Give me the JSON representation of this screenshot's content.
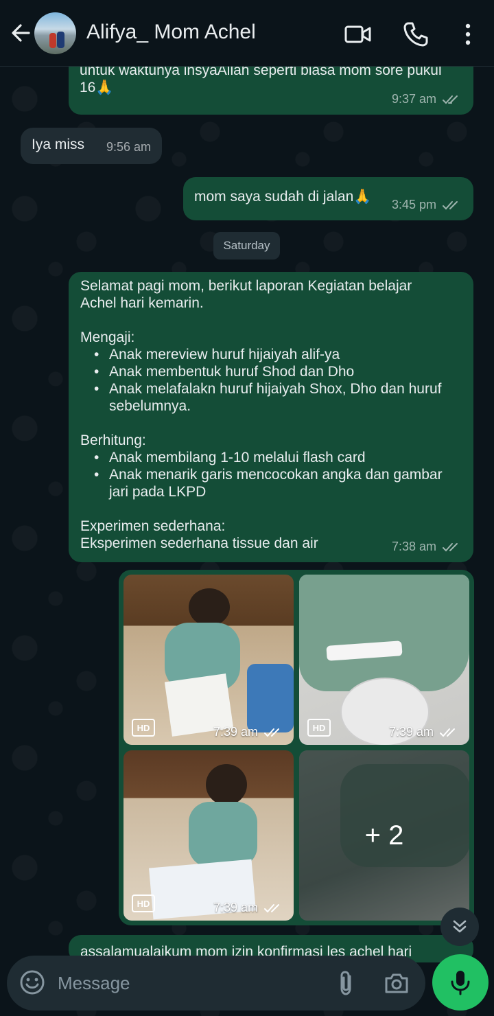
{
  "header": {
    "contact_name": "Alifya_ Mom Achel"
  },
  "messages": [
    {
      "text": "untuk waktunya insyaAllah seperti biasa mom sore pukul 16🙏",
      "line1": "untuk waktunya insyaAllah seperti biasa mom sore pukul",
      "line2": "16🙏",
      "time": "9:37 am",
      "direction": "outgoing"
    },
    {
      "text": "Iya miss",
      "time": "9:56 am",
      "direction": "incoming"
    },
    {
      "text": "mom saya sudah di jalan🙏",
      "time": "3:45 pm",
      "direction": "outgoing"
    }
  ],
  "date_divider": "Saturday",
  "report": {
    "greeting_l1": "Selamat pagi mom,  berikut laporan Kegiatan belajar",
    "greeting_l2": "Achel hari kemarin.",
    "mengaji_title": "Mengaji:",
    "mengaji_items": [
      "Anak mereview huruf hijaiyah alif-ya",
      "Anak membentuk huruf Shod dan Dho",
      "Anak melafalakn huruf hijaiyah Shox, Dho dan huruf sebelumnya."
    ],
    "berhitung_title": "Berhitung:",
    "berhitung_items": [
      "Anak membilang 1-10 melalui flash card",
      "Anak menarik garis mencocokan angka dan gambar jari pada LKPD"
    ],
    "experimen_title": "Experimen sederhana:",
    "experimen_text": "Eksperimen sederhana tissue dan air",
    "time": "7:38 am"
  },
  "media": {
    "items": [
      {
        "badge": "HD",
        "time": "7:39 am"
      },
      {
        "badge": "HD",
        "time": "7:39 am"
      },
      {
        "badge": "HD",
        "time": "7:39 am"
      }
    ],
    "more_count": "+ 2"
  },
  "partial_message": "assalamualaikum mom izin konfirmasi les achel hari",
  "composer": {
    "placeholder": "Message"
  },
  "colors": {
    "background": "#0b141a",
    "outgoing_bubble": "#144d37",
    "incoming_bubble": "#202c33",
    "mic_button": "#21c063"
  }
}
